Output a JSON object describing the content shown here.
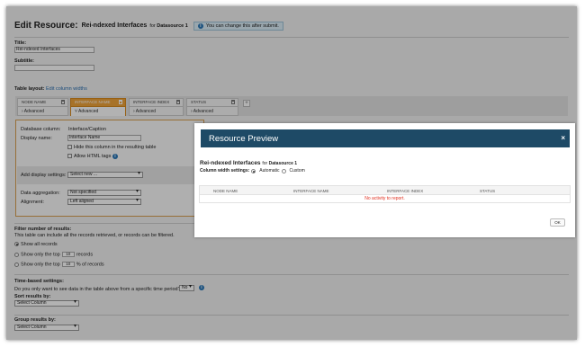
{
  "page": {
    "heading": "Edit Resource:",
    "resource_name": "Rei-ndexed Interfaces",
    "for_text": "for",
    "datasource": "Datasource 1",
    "note": "You can change this after submit."
  },
  "form": {
    "title_label": "Title:",
    "title_value": "Rei-ndexed Interfaces",
    "subtitle_label": "Subtitle:",
    "subtitle_value": "",
    "table_layout_label": "Table layout:",
    "edit_column_widths": "Edit column widths"
  },
  "columns": [
    {
      "name": "NODE NAME",
      "advanced": "Advanced"
    },
    {
      "name": "INTERFACE NAME",
      "advanced": "Advanced"
    },
    {
      "name": "INTERFACE INDEX",
      "advanced": "Advanced"
    },
    {
      "name": "STATUS",
      "advanced": "Advanced"
    }
  ],
  "editor": {
    "db_column_label": "Database column:",
    "db_column_value": "Interface/Caption",
    "display_name_label": "Display name:",
    "display_name_value": "Interface Name",
    "hide_column": "Hide this column in the resulting table",
    "allow_html": "Allow HTML tags",
    "add_display_label": "Add display settings:",
    "add_display_value": "Select new ...",
    "aggregation_label": "Data aggregation:",
    "aggregation_value": "Not specified",
    "alignment_label": "Alignment:",
    "alignment_value": "Left aligned"
  },
  "filter": {
    "heading": "Filter number of results:",
    "desc": "This table can include all the records retrieved, or records can be filtered.",
    "opt_all": "Show all records",
    "opt_top_prefix": "Show only the top",
    "opt_top_value": "10",
    "opt_top_suffix": "records",
    "opt_pct_prefix": "Show only the top",
    "opt_pct_value": "10",
    "opt_pct_suffix": "% of records"
  },
  "time": {
    "heading": "Time-based settings:",
    "question": "Do you only want to see data in the table above from a specific time period?",
    "value": "No"
  },
  "sort": {
    "label": "Sort results by:",
    "value": "Select Column"
  },
  "group": {
    "label": "Group results by:",
    "value": "Select Column"
  },
  "modal": {
    "title": "Resource Preview",
    "close": "×",
    "resource_name": "Rei-ndexed Interfaces",
    "for_text": "for",
    "datasource": "Datasource 1",
    "cw_label": "Column width settings:",
    "cw_auto": "Automatic",
    "cw_custom": "Custom",
    "headers": [
      "NODE NAME",
      "INTERFACE NAME",
      "INTERFACE INDEX",
      "STATUS"
    ],
    "empty": "No activity to report.",
    "ok": "OK"
  },
  "colors": {
    "accent": "#f0a43a",
    "modal_header": "#1e4a66",
    "link": "#2a6fb0",
    "error": "#e03020"
  }
}
